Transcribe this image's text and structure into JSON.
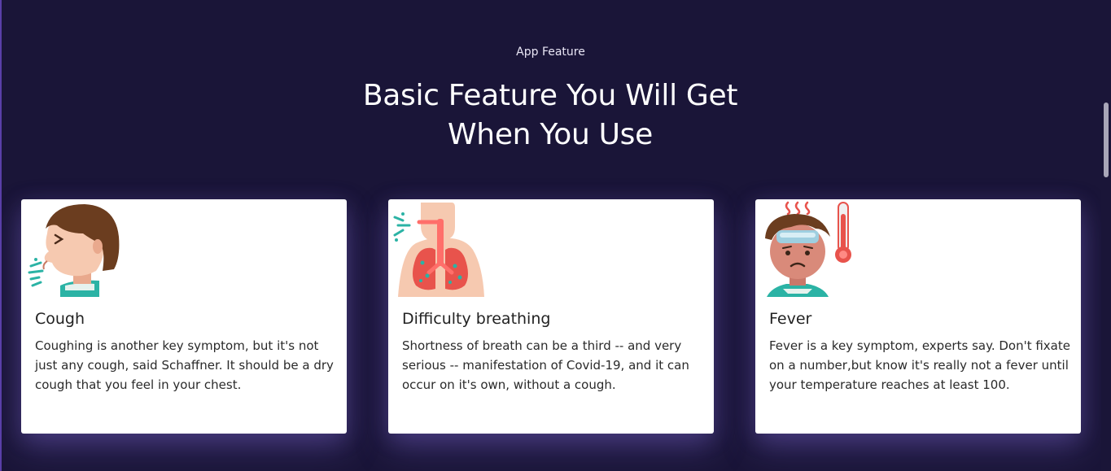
{
  "section": {
    "eyebrow": "App Feature",
    "headline_line1": "Basic Feature You Will Get",
    "headline_line2": "When You Use"
  },
  "cards": [
    {
      "icon": "coughing-person-icon",
      "title": "Cough",
      "text": "Coughing is another key symptom, but it's not just any cough, said Schaffner. It should be a dry cough that you feel in your chest."
    },
    {
      "icon": "lungs-breathing-icon",
      "title": "Difficulty breathing",
      "text": "Shortness of breath can be a third -- and very serious -- manifestation of Covid-19, and it can occur on it's own, without a cough."
    },
    {
      "icon": "fever-thermometer-icon",
      "title": "Fever",
      "text": "Fever is a key symptom, experts say. Don't fixate on a number,but know it's really not a fever until your temperature reaches at least 100."
    }
  ],
  "colors": {
    "background": "#1a1538",
    "card": "#ffffff",
    "text_dark": "#222222",
    "accent_teal": "#2bb3a5",
    "accent_red": "#e8534c"
  }
}
